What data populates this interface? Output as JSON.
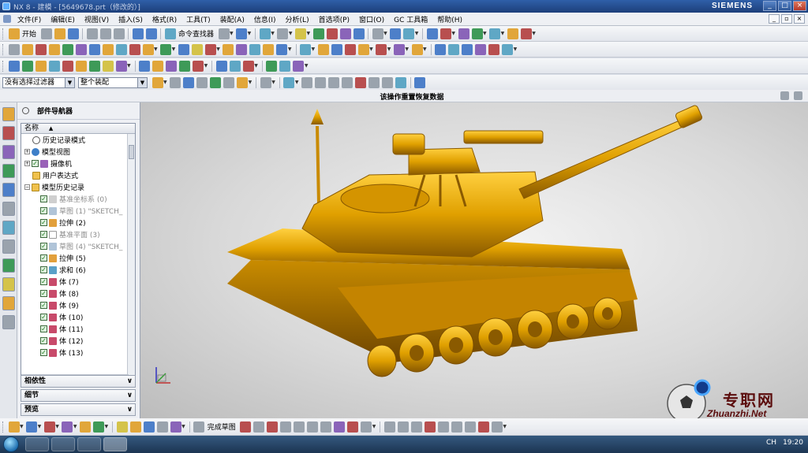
{
  "window": {
    "title": "NX 8 - 建模 - [5649678.prt（修改的）]",
    "brand": "SIEMENS"
  },
  "menubar": {
    "items": [
      "文件(F)",
      "编辑(E)",
      "视图(V)",
      "插入(S)",
      "格式(R)",
      "工具(T)",
      "装配(A)",
      "信息(I)",
      "分析(L)",
      "首选项(P)",
      "窗口(O)",
      "GC 工具箱",
      "帮助(H)"
    ]
  },
  "toolbar": {
    "start_label": "开始",
    "command_finder_label": "命令查找器"
  },
  "filterbar": {
    "selection_filter": "没有选择过滤器",
    "assembly_scope": "整个装配"
  },
  "status": {
    "message": "该操作重置恢复数据"
  },
  "navigator": {
    "title": "部件导航器",
    "column_header": "名称",
    "rows": [
      {
        "label": "历史记录模式",
        "indent": 1
      },
      {
        "label": "模型视图",
        "indent": 0
      },
      {
        "label": "摄像机",
        "indent": 0
      },
      {
        "label": "用户表达式",
        "indent": 1
      },
      {
        "label": "模型历史记录",
        "indent": 0
      },
      {
        "label": "基准坐标系 (0)",
        "indent": 2,
        "grey": true
      },
      {
        "label": "草图 (1) \"SKETCH_",
        "indent": 2,
        "grey": true
      },
      {
        "label": "拉伸 (2)",
        "indent": 2
      },
      {
        "label": "基准平面 (3)",
        "indent": 2,
        "grey": true
      },
      {
        "label": "草图 (4) \"SKETCH_",
        "indent": 2,
        "grey": true
      },
      {
        "label": "拉伸 (5)",
        "indent": 2
      },
      {
        "label": "求和 (6)",
        "indent": 2
      },
      {
        "label": "体 (7)",
        "indent": 2
      },
      {
        "label": "体 (8)",
        "indent": 2
      },
      {
        "label": "体 (9)",
        "indent": 2
      },
      {
        "label": "体 (10)",
        "indent": 2
      },
      {
        "label": "体 (11)",
        "indent": 2
      },
      {
        "label": "体 (12)",
        "indent": 2
      },
      {
        "label": "体 (13)",
        "indent": 2
      }
    ],
    "panels": [
      "相依性",
      "细节",
      "预览"
    ]
  },
  "bottombar": {
    "finish_sketch_label": "完成草图"
  },
  "watermark": {
    "text": "专职网",
    "url": "Zhuanzhi.Net"
  },
  "taskbar": {
    "lang": "CH",
    "time": "19:20"
  },
  "colors": {
    "model": "#e0a000",
    "titlebar": "#2f5fa8",
    "watermark": "#5b0d0d"
  }
}
